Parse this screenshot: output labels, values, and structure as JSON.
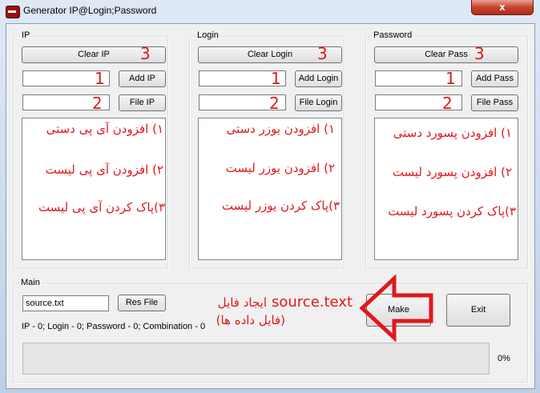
{
  "window": {
    "title": "Generator IP@Login;Password",
    "close_label": "x"
  },
  "ip": {
    "legend": "IP",
    "clear_label": "Clear IP",
    "add_label": "Add IP",
    "file_label": "File IP",
    "input_value": "",
    "file_value": ""
  },
  "login": {
    "legend": "Login",
    "clear_label": "Clear Login",
    "add_label": "Add Login",
    "file_label": "File Login",
    "input_value": "",
    "file_value": ""
  },
  "password": {
    "legend": "Password",
    "clear_label": "Clear Pass",
    "add_label": "Add Pass",
    "file_label": "File Pass",
    "input_value": "",
    "file_value": ""
  },
  "annotations": {
    "num1": "1",
    "num2": "2",
    "num3": "3",
    "ip_lines": [
      "۱) افزودن آی پی دستی",
      "۲) افزودن آی پی لیست",
      "۳)پاک کردن آی پی لیست"
    ],
    "login_lines": [
      "۱) افزودن یوزر دستی",
      "۲) افزودن یوزر لیست",
      "۳)پاک کردن یوزر لیست"
    ],
    "pass_lines": [
      "۱) افزودن پسورد دستی",
      "۲) افزودن پسورد لیست",
      "۳)پاک کردن پسورد لیست"
    ],
    "source_en": "source.text",
    "source_fa": "ایجاد فایل",
    "source_sub": "(فایل داده ها)"
  },
  "main": {
    "legend": "Main",
    "source_value": "source.txt",
    "res_file_label": "Res File",
    "stats": "IP - 0; Login - 0; Password - 0; Combination - 0",
    "make_label": "Make",
    "exit_label": "Exit",
    "progress_percent": 0,
    "progress_text": "0%"
  },
  "colors": {
    "annotation": "#e0181c",
    "titlebar": "#bcd0e6",
    "close": "#c7432e"
  }
}
